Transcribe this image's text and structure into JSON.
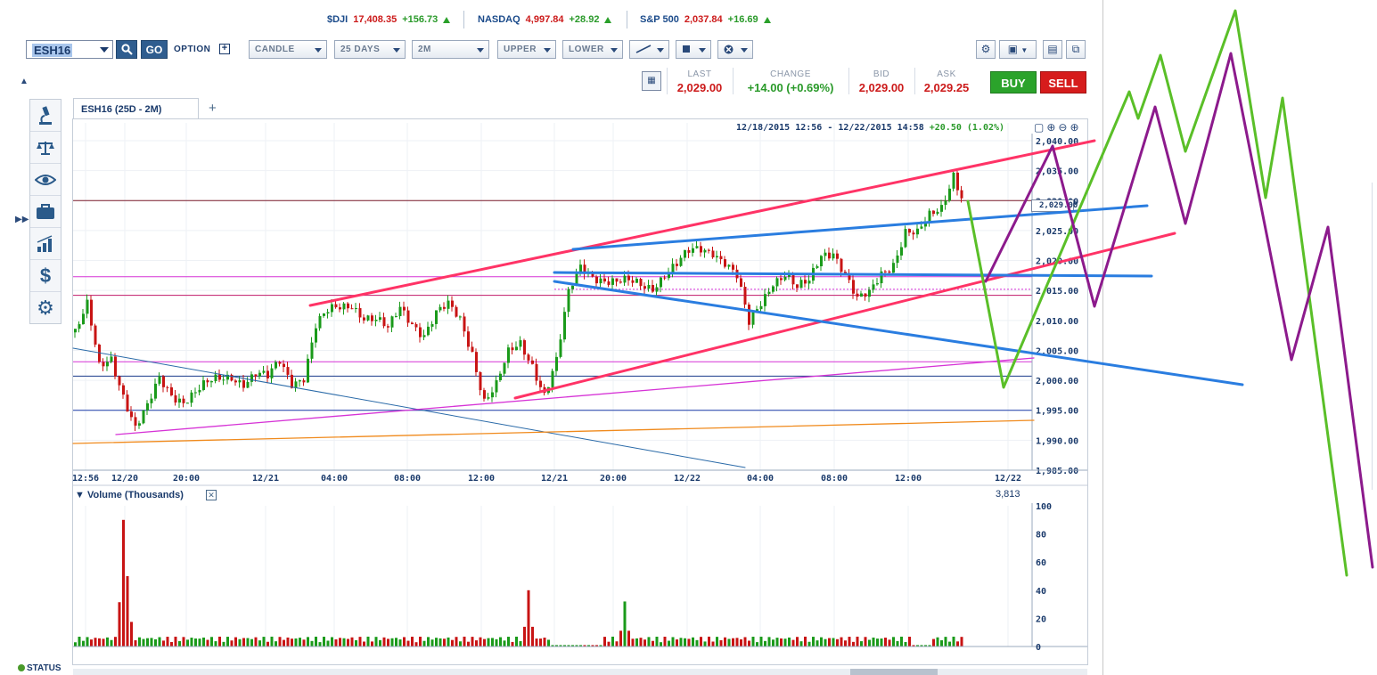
{
  "ticker": [
    {
      "symbol": "$DJI",
      "value": "17,408.35",
      "change": "+156.73"
    },
    {
      "symbol": "NASDAQ",
      "value": "4,997.84",
      "change": "+28.92"
    },
    {
      "symbol": "S&P 500",
      "value": "2,037.84",
      "change": "+16.69"
    }
  ],
  "toolbar": {
    "symbol": "ESH16",
    "go_label": "GO",
    "option_label": "OPTION",
    "dropdowns": [
      "CANDLE",
      "25 DAYS",
      "2M",
      "UPPER",
      "LOWER"
    ]
  },
  "quote": {
    "last_label": "LAST",
    "last": "2,029.00",
    "change_label": "CHANGE",
    "change": "+14.00 (+0.69%)",
    "bid_label": "BID",
    "bid": "2,029.00",
    "ask_label": "ASK",
    "ask": "2,029.25",
    "buy_label": "BUY",
    "sell_label": "SELL"
  },
  "chart": {
    "tab_label": "ESH16 (25D - 2M)",
    "date_range": "12/18/2015 12:56 - 12/22/2015 14:58",
    "range_change": "+20.50 (1.02%)",
    "current_price_flag": "2,029.00",
    "volume_title": "Volume (Thousands)",
    "volume_last": "3,813",
    "status_label": "STATUS"
  },
  "chart_data": {
    "type": "candlestick",
    "price_axis": [
      "2,040.00",
      "2,035.00",
      "2,030.00",
      "2,025.00",
      "2,020.00",
      "2,015.00",
      "2,010.00",
      "2,005.00",
      "2,000.00",
      "1,995.00",
      "1,990.00",
      "1,985.00"
    ],
    "time_axis": [
      "12:56",
      "12/20",
      "20:00",
      "12/21",
      "04:00",
      "08:00",
      "12:00",
      "12/21",
      "20:00",
      "12/22",
      "04:00",
      "08:00",
      "12:00",
      "12/22"
    ],
    "volume_axis": [
      "100",
      "80",
      "60",
      "40",
      "20",
      "0"
    ],
    "ylim": [
      1983,
      2041
    ],
    "price_path": [
      [
        0,
        2008
      ],
      [
        3,
        2012
      ],
      [
        6,
        2002
      ],
      [
        9,
        2004
      ],
      [
        12,
        1998
      ],
      [
        15,
        1992
      ],
      [
        18,
        1995
      ],
      [
        21,
        2000
      ],
      [
        24,
        1998
      ],
      [
        27,
        1997
      ],
      [
        30,
        1998
      ],
      [
        33,
        1999
      ],
      [
        36,
        2000
      ],
      [
        39,
        2001
      ],
      [
        42,
        2000
      ],
      [
        45,
        2001
      ],
      [
        48,
        2000
      ],
      [
        51,
        2003
      ],
      [
        54,
        2000
      ],
      [
        57,
        2001
      ],
      [
        60,
        2009
      ],
      [
        63,
        2011
      ],
      [
        66,
        2012
      ],
      [
        69,
        2013
      ],
      [
        72,
        2011
      ],
      [
        75,
        2010
      ],
      [
        78,
        2008
      ],
      [
        81,
        2012
      ],
      [
        84,
        2010
      ],
      [
        87,
        2008
      ],
      [
        90,
        2011
      ],
      [
        93,
        2012
      ],
      [
        96,
        2010
      ],
      [
        99,
        2005
      ],
      [
        102,
        1997
      ],
      [
        105,
        1999
      ],
      [
        108,
        2004
      ],
      [
        111,
        2006
      ],
      [
        114,
        2003
      ],
      [
        117,
        1998
      ],
      [
        120,
        2003
      ],
      [
        123,
        2014
      ],
      [
        126,
        2019
      ],
      [
        129,
        2018
      ],
      [
        132,
        2017
      ],
      [
        135,
        2016
      ],
      [
        138,
        2016
      ],
      [
        141,
        2016
      ],
      [
        144,
        2016
      ],
      [
        147,
        2018
      ],
      [
        150,
        2019
      ],
      [
        153,
        2021
      ],
      [
        156,
        2022
      ],
      [
        159,
        2022
      ],
      [
        162,
        2020
      ],
      [
        165,
        2017
      ],
      [
        168,
        2009
      ],
      [
        171,
        2013
      ],
      [
        174,
        2017
      ],
      [
        177,
        2018
      ],
      [
        180,
        2015
      ],
      [
        183,
        2016
      ],
      [
        186,
        2021
      ],
      [
        189,
        2022
      ],
      [
        192,
        2018
      ],
      [
        195,
        2013
      ],
      [
        198,
        2014
      ],
      [
        201,
        2018
      ],
      [
        204,
        2020
      ],
      [
        207,
        2025
      ],
      [
        210,
        2024
      ],
      [
        213,
        2027
      ],
      [
        216,
        2029
      ],
      [
        219,
        2035
      ],
      [
        222,
        2029
      ]
    ],
    "volume_spikes": [
      [
        12,
        90
      ],
      [
        13,
        50
      ],
      [
        113,
        40
      ],
      [
        137,
        32
      ],
      [
        234,
        20
      ]
    ]
  },
  "colors": {
    "red_trend": "#ff3366",
    "blue_trend": "#2a7de0",
    "green_projection": "#5abf28",
    "purple_projection": "#8c1a8c",
    "magenta_level": "#d633d6",
    "orange_level": "#f08a1c"
  },
  "icons": [
    "microscope-icon",
    "scale-icon",
    "eye-icon",
    "briefcase-icon",
    "bar-chart-icon",
    "dollar-icon",
    "gear-icon"
  ]
}
